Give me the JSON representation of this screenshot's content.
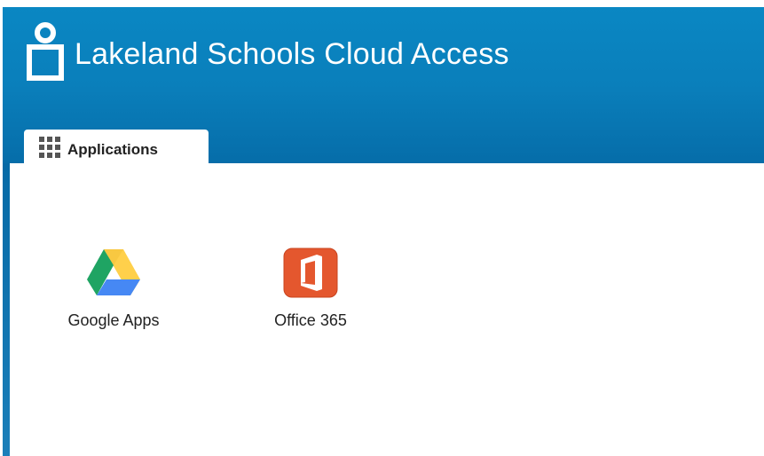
{
  "header": {
    "title": "Lakeland Schools Cloud Access",
    "user_icon": "user-icon"
  },
  "tabs": [
    {
      "label": "Applications",
      "icon": "apps-grid-icon",
      "active": true
    }
  ],
  "apps": [
    {
      "label": "Google Apps",
      "icon": "google-drive-icon"
    },
    {
      "label": "Office 365",
      "icon": "office-365-icon"
    }
  ],
  "colors": {
    "header_blue": "#0a7fbb",
    "office_orange": "#e4572e",
    "drive_green": "#1fa463",
    "drive_yellow": "#ffd04b",
    "drive_blue": "#4688f4"
  }
}
